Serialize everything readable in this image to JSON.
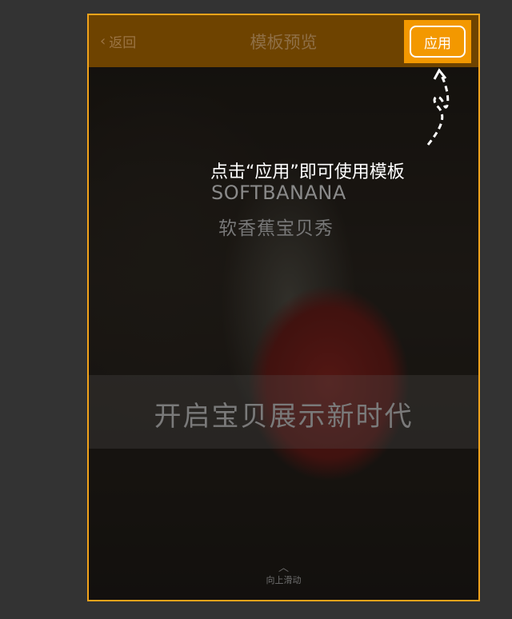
{
  "header": {
    "back_label": "返回",
    "title": "模板预览",
    "apply_label": "应用"
  },
  "hint": {
    "text": "点击“应用”即可使用模板"
  },
  "preview": {
    "brand_en": "SOFTBANANA",
    "brand_cn": "软香蕉宝贝秀",
    "slogan": "开启宝贝展示新时代",
    "swipe_label": "向上滑动"
  },
  "colors": {
    "accent": "#f39800",
    "frame_border": "#f2a31b",
    "header_bg": "#6e4300",
    "page_bg": "#333333"
  },
  "icons": {
    "back": "chevron-left-icon",
    "hint": "dashed-arrow-icon",
    "swipe": "chevron-up-icon"
  }
}
